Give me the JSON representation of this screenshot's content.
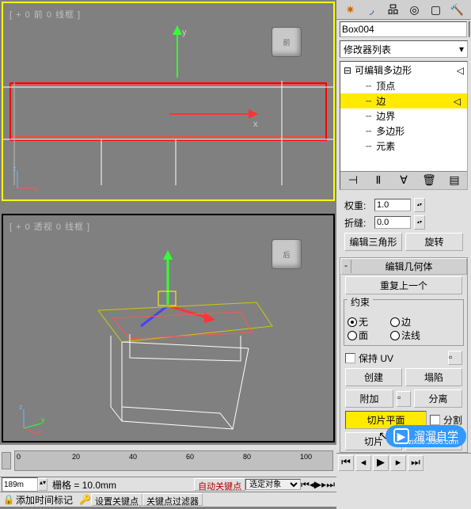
{
  "viewports": {
    "front": {
      "label": "[ + 0 前 0 线框 ]",
      "cube": "前"
    },
    "persp": {
      "label": "[ + 0 透视 0 线框 ]",
      "cube": "后"
    }
  },
  "name_field": "Box004",
  "modifier_list_label": "修改器列表",
  "stack": {
    "root": "可编辑多边形",
    "items": [
      "顶点",
      "边",
      "边界",
      "多边形",
      "元素"
    ],
    "selected_index": 1
  },
  "edge_panel": {
    "weight_label": "权重:",
    "weight_value": "1.0",
    "crease_label": "折缝:",
    "crease_value": "0.0",
    "btn_edit_tri": "编辑三角形",
    "btn_rotate": "旋转"
  },
  "geom_panel": {
    "title": "编辑几何体",
    "repeat_last": "重复上一个",
    "constraint_label": "约束",
    "r_none": "无",
    "r_edge": "边",
    "r_face": "面",
    "r_normal": "法线",
    "preserve_uv": "保持 UV",
    "btn_create": "创建",
    "btn_collapse": "塌陷",
    "btn_attach": "附加",
    "btn_detach": "分离",
    "btn_slice_plane": "切片平面",
    "chk_split": "分割",
    "btn_slice": "切片",
    "btn_reset_plane": "重置平面"
  },
  "timeline": {
    "ticks": [
      "0",
      "20",
      "40",
      "60",
      "80",
      "100"
    ]
  },
  "status": {
    "frame": "189m",
    "grid_label": "栅格 = 10.0mm",
    "auto_key": "自动关键点",
    "sel_mode": "选定对象",
    "add_time": "添加时间标记",
    "set_key": "设置关键点",
    "key_filter": "关键点过滤器"
  },
  "transport": {
    "title1": "溜溜自学",
    "title2": "zixue.3d66.com"
  }
}
